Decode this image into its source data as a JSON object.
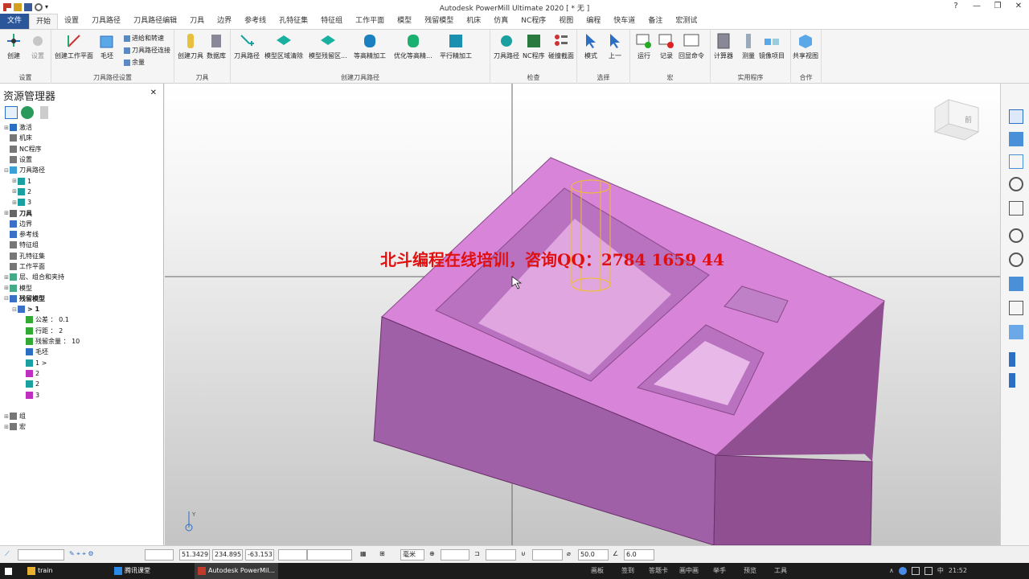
{
  "window": {
    "title": "Autodesk PowerMill Ultimate 2020    [ * 无 ]",
    "help": "?",
    "min": "—",
    "restore": "❐",
    "close": "✕"
  },
  "tabs": [
    "文件",
    "开始",
    "设置",
    "刀具路径",
    "刀具路径编辑",
    "刀具",
    "边界",
    "参考线",
    "孔特征集",
    "特征组",
    "工作平面",
    "模型",
    "残留模型",
    "机床",
    "仿真",
    "NC程序",
    "视图",
    "编程",
    "快车道",
    "备注",
    "宏测试"
  ],
  "ribbon": {
    "groups": [
      {
        "label": "设置",
        "buttons": [
          "创建",
          "设置"
        ]
      },
      {
        "label": "刀具路径设置",
        "buttons": [
          "创建工作平面",
          "毛坯"
        ],
        "small": [
          "进给和转速",
          "刀具路径连接",
          "余量"
        ]
      },
      {
        "label": "刀具",
        "buttons": [
          "创建刀具",
          "数据库"
        ]
      },
      {
        "label": "创建刀具路径",
        "buttons": [
          "刀具路径",
          "模型区域清除",
          "模型残留区...",
          "等高精加工",
          "优化等高精...",
          "平行精加工"
        ]
      },
      {
        "label": "检查",
        "buttons": [
          "刀具路径",
          "NC程序",
          "碰撞截面"
        ]
      },
      {
        "label": "选择",
        "buttons": [
          "模式",
          "上一"
        ]
      },
      {
        "label": "宏",
        "buttons": [
          "运行",
          "记录",
          "回显命令"
        ]
      },
      {
        "label": "实用程序",
        "buttons": [
          "计算器",
          "测量",
          "镜像项目"
        ]
      },
      {
        "label": "合作",
        "buttons": [
          "共享视图"
        ]
      }
    ]
  },
  "explorer": {
    "title": "资源管理器",
    "items": [
      {
        "label": "激活",
        "indent": 0,
        "exp": "+",
        "color": "#2a6fc4"
      },
      {
        "label": "机床",
        "indent": 0,
        "exp": "",
        "color": "#777"
      },
      {
        "label": "NC程序",
        "indent": 0,
        "exp": "",
        "color": "#777"
      },
      {
        "label": "设置",
        "indent": 0,
        "exp": "",
        "color": "#777"
      },
      {
        "label": "刀具路径",
        "indent": 0,
        "exp": "-",
        "color": "#3aa0d8"
      },
      {
        "label": "1",
        "indent": 1,
        "exp": "+",
        "color": "#1aa0a0"
      },
      {
        "label": "2",
        "indent": 1,
        "exp": "+",
        "color": "#1aa0a0"
      },
      {
        "label": "3",
        "indent": 1,
        "exp": "+",
        "color": "#1aa0a0"
      },
      {
        "label": "刀具",
        "indent": 0,
        "exp": "+",
        "color": "#666",
        "bold": true
      },
      {
        "label": "边界",
        "indent": 0,
        "exp": "",
        "color": "#3a70c8"
      },
      {
        "label": "参考线",
        "indent": 0,
        "exp": "",
        "color": "#3a70c8"
      },
      {
        "label": "特征组",
        "indent": 0,
        "exp": "",
        "color": "#777"
      },
      {
        "label": "孔特征集",
        "indent": 0,
        "exp": "",
        "color": "#777"
      },
      {
        "label": "工作平面",
        "indent": 0,
        "exp": "",
        "color": "#777"
      },
      {
        "label": "层、组合和夹持",
        "indent": 0,
        "exp": "+",
        "color": "#4a8"
      },
      {
        "label": "模型",
        "indent": 0,
        "exp": "+",
        "color": "#4a8"
      },
      {
        "label": "残留模型",
        "indent": 0,
        "exp": "-",
        "color": "#3a70c8",
        "bold": true
      },
      {
        "label": "> 1",
        "indent": 1,
        "exp": "-",
        "color": "#3a70c8",
        "bold": true
      },
      {
        "label": "公差 ： 0.1",
        "indent": 2,
        "exp": "",
        "color": "#3a3"
      },
      {
        "label": "行距 ： 2",
        "indent": 2,
        "exp": "",
        "color": "#3a3"
      },
      {
        "label": "残留余量 ： 10",
        "indent": 2,
        "exp": "",
        "color": "#3a3"
      },
      {
        "label": "毛坯",
        "indent": 2,
        "exp": "",
        "color": "#2a6fc4"
      },
      {
        "label": "1 >",
        "indent": 2,
        "exp": "",
        "color": "#1aa0a0"
      },
      {
        "label": "2",
        "indent": 2,
        "exp": "",
        "color": "#c030c0"
      },
      {
        "label": "2",
        "indent": 2,
        "exp": "",
        "color": "#1aa0a0"
      },
      {
        "label": "3",
        "indent": 2,
        "exp": "",
        "color": "#c030c0"
      },
      {
        "label": "",
        "indent": 0,
        "exp": "",
        "color": "transparent"
      },
      {
        "label": "组",
        "indent": 0,
        "exp": "+",
        "color": "#777"
      },
      {
        "label": "宏",
        "indent": 0,
        "exp": "+",
        "color": "#777"
      }
    ]
  },
  "overlay_text": "北斗编程在线培训，咨询QQ：2784 1659 44",
  "status": {
    "x": "51.3429",
    "y": "234.895",
    "z": "-63.153",
    "unit": "毫米",
    "tol": "50.0",
    "step": "6.0"
  },
  "viewcube_label": "前",
  "axis_label": "Y",
  "taskbar": {
    "items": [
      "train",
      "腾讯课堂",
      "Autodesk PowerMil..."
    ],
    "tray": [
      "画板",
      "签到",
      "答题卡",
      "画中画",
      "举手",
      "预览",
      "工具"
    ],
    "time": "21:52"
  },
  "colors": {
    "accent": "#2b579a",
    "model": "#d884d8",
    "model_side": "#8f4f90",
    "model_front": "#a060a8"
  }
}
